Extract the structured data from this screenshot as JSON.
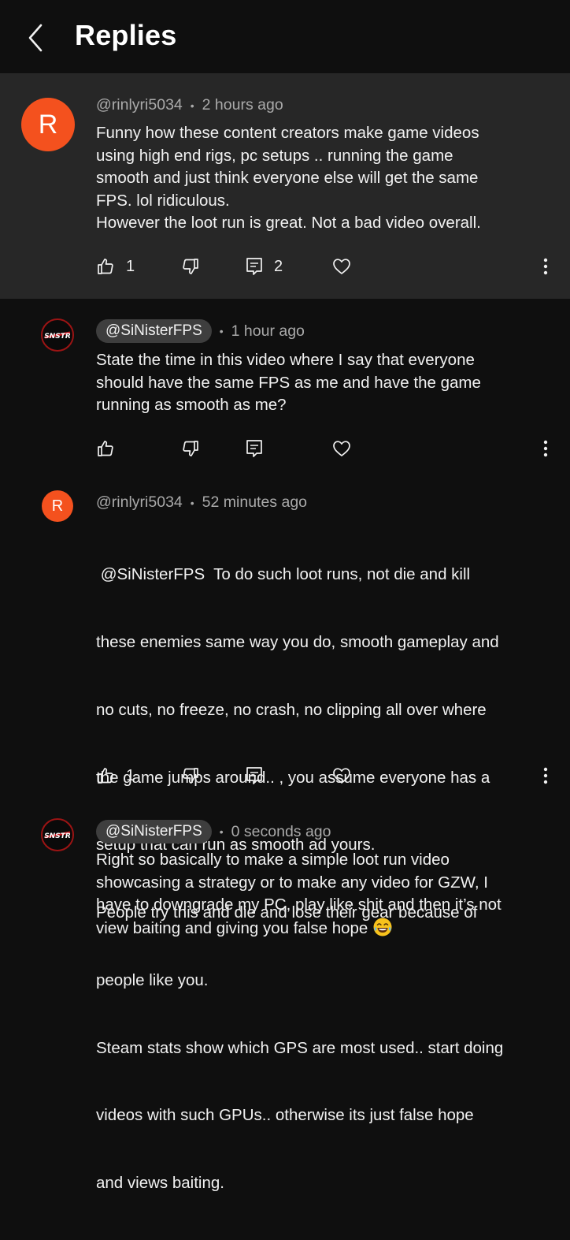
{
  "header": {
    "title": "Replies"
  },
  "parent": {
    "avatar_letter": "R",
    "author": "@rinlyri5034",
    "time": "2 hours ago",
    "lines": [
      "Funny how these content creators make game videos",
      "using high end rigs, pc setups .. running the game",
      "smooth and just think everyone else will get the same",
      "FPS. lol ridiculous.",
      "However the loot run is great. Not a bad video overall."
    ],
    "likes": "1",
    "replies": "2"
  },
  "replies": [
    {
      "author": "@SiNisterFPS",
      "time": "1 hour ago",
      "lines": [
        "State the time in this video where I say that everyone",
        "should have the same FPS as me and have the game",
        "running as smooth as me?"
      ],
      "likes": ""
    },
    {
      "avatar_letter": "R",
      "author": "@rinlyri5034",
      "time": "52 minutes ago",
      "lines": [
        " @SiNisterFPS  To do such loot runs, not die and kill",
        "these enemies same way you do, smooth gameplay and",
        "no cuts, no freeze, no crash, no clipping all over where",
        "the game jumps around.. , you assume everyone has a",
        "setup that can run as smooth ad yours.",
        "People try this and die and lose their gear because of",
        "people like you.",
        "Steam stats show which GPS are most used.. start doing",
        "videos with such GPUs.. otherwise its just false hope",
        "and views baiting."
      ],
      "likes": "1"
    },
    {
      "author": "@SiNisterFPS",
      "time": "0 seconds ago",
      "lines": [
        "Right so basically to make a simple loot run video",
        "showcasing a strategy or to make any video for GZW, I",
        "have to downgrade my PC, play like shit and then it’s not",
        "view baiting and giving you false hope"
      ]
    }
  ],
  "colors": {
    "parent_bg": "#272727",
    "page_bg": "#0f0f0f",
    "avatar_orange": "#f4511e",
    "meta_gray": "#aaaaaa"
  },
  "icons": [
    "back-chevron-icon",
    "thumbs-up-icon",
    "thumbs-down-icon",
    "reply-icon",
    "heart-icon",
    "more-vert-icon",
    "laughing-emoji-icon"
  ]
}
